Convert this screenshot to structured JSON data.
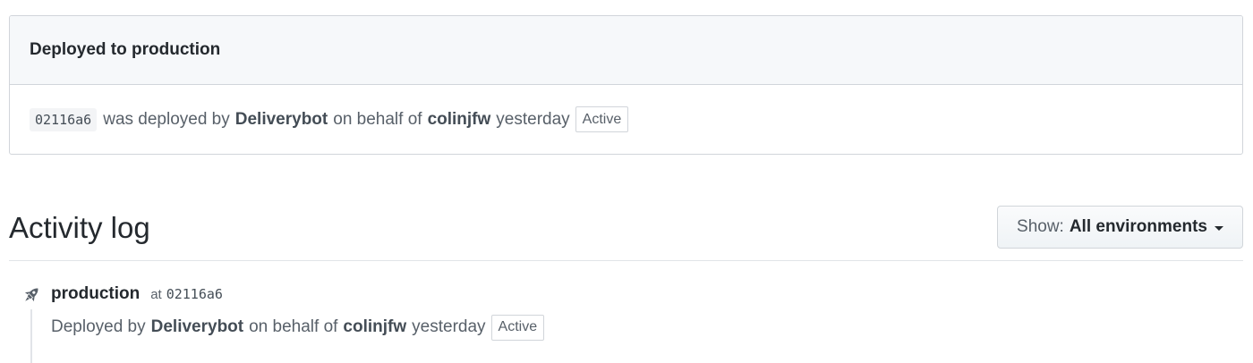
{
  "deployment": {
    "title": "Deployed to production",
    "sha": "02116a6",
    "text_deployed_by": "was deployed by",
    "actor": "Deliverybot",
    "text_on_behalf": "on behalf of",
    "user": "colinjfw",
    "time": "yesterday",
    "status": "Active"
  },
  "activity": {
    "title": "Activity log",
    "filter_prefix": "Show:",
    "filter_value": "All environments",
    "entries": [
      {
        "icon": "rocket-icon",
        "environment": "production",
        "at_label": "at",
        "sha": "02116a6",
        "text_deployed_by": "Deployed by",
        "actor": "Deliverybot",
        "text_on_behalf": "on behalf of",
        "user": "colinjfw",
        "time": "yesterday",
        "status": "Active"
      }
    ]
  },
  "colors": {
    "text_primary": "#24292e",
    "text_secondary": "#586069",
    "border": "#d1d5da",
    "header_bg": "#f6f8fa"
  }
}
